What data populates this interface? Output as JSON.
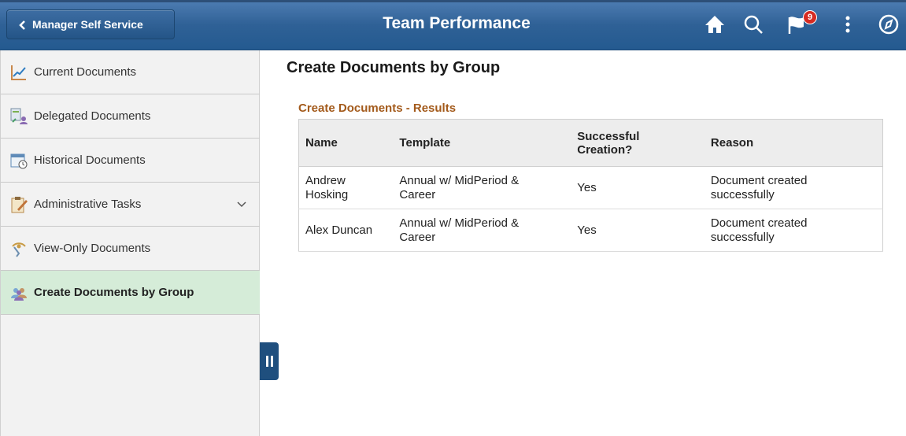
{
  "header": {
    "back_label": "Manager Self Service",
    "title": "Team Performance",
    "notification_count": "9",
    "icons": [
      "home-icon",
      "search-icon",
      "notification-flag-icon",
      "actions-menu-icon",
      "navbar-compass-icon"
    ],
    "colors": {
      "bar": "#2f6196",
      "badge": "#d62b22"
    }
  },
  "sidebar": {
    "items": [
      {
        "label": "Current Documents",
        "icon": "line-chart-icon"
      },
      {
        "label": "Delegated Documents",
        "icon": "delegate-people-icon"
      },
      {
        "label": "Historical Documents",
        "icon": "calendar-clock-icon"
      },
      {
        "label": "Administrative Tasks",
        "icon": "clipboard-pencil-icon",
        "expandable": true
      },
      {
        "label": "View-Only Documents",
        "icon": "view-only-icon"
      },
      {
        "label": "Create Documents by Group",
        "icon": "group-people-icon",
        "active": true
      }
    ],
    "active_color": "#d5ecd8"
  },
  "main": {
    "title": "Create Documents by Group",
    "results_title": "Create Documents - Results",
    "results_title_color": "#a35a1b",
    "table": {
      "headers": [
        "Name",
        "Template",
        "Successful Creation?",
        "Reason"
      ],
      "rows": [
        [
          "Andrew Hosking",
          "Annual w/ MidPeriod & Career",
          "Yes",
          "Document created successfully"
        ],
        [
          "Alex Duncan",
          "Annual w/ MidPeriod & Career",
          "Yes",
          "Document created successfully"
        ]
      ]
    }
  }
}
